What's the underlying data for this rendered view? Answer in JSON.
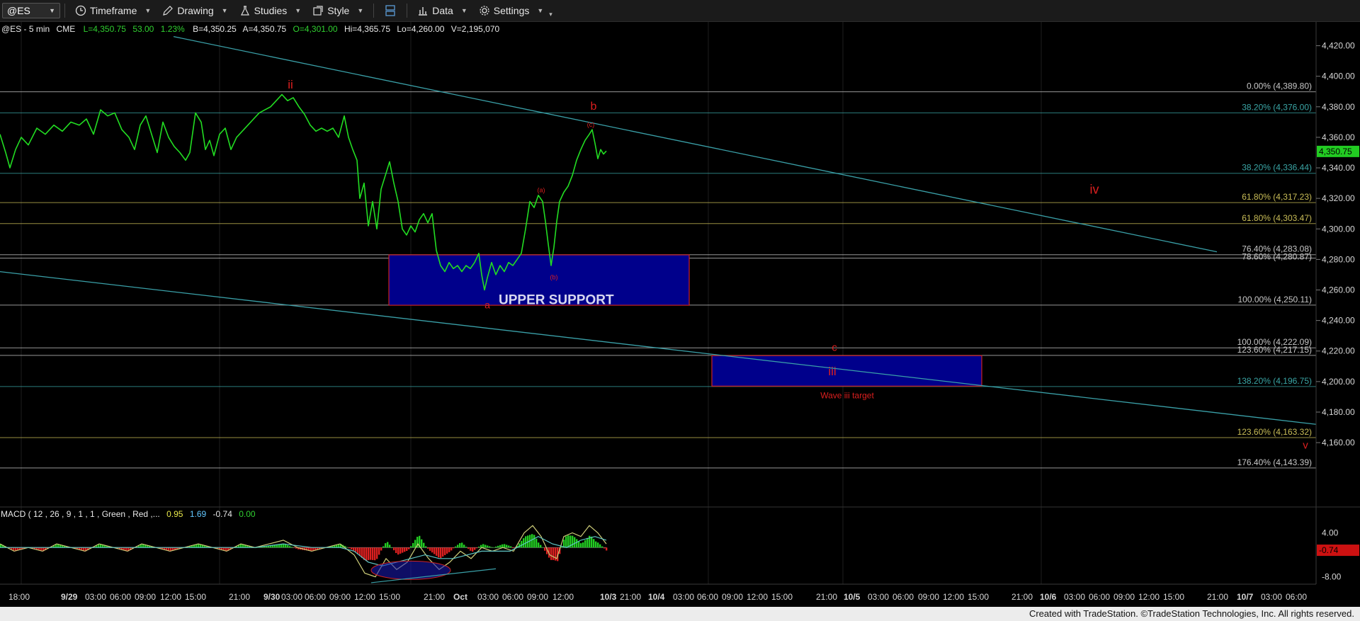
{
  "toolbar": {
    "symbol": "@ES",
    "timeframe_label": "Timeframe",
    "drawing_label": "Drawing",
    "studies_label": "Studies",
    "style_label": "Style",
    "data_label": "Data",
    "settings_label": "Settings"
  },
  "header": {
    "symbol_interval": "@ES - 5 min",
    "exchange": "CME",
    "last": "L=4,350.75",
    "change": "53.00",
    "change_pct": "1.23%",
    "bid": "B=4,350.25",
    "ask": "A=4,350.75",
    "open": "O=4,301.00",
    "high": "Hi=4,365.75",
    "low": "Lo=4,260.00",
    "volume": "V=2,195,070"
  },
  "macd_header": {
    "label": "MACD ( 12 , 26 , 9 , 1 , 1 , Green , Red ,...",
    "v1": "0.95",
    "v2": "1.69",
    "v3": "-0.74",
    "v4": "0.00"
  },
  "chart_data": {
    "type": "line",
    "symbol": "@ES",
    "interval": "5 min",
    "ylim": [
      4135,
      4430
    ],
    "y_ticks": [
      "4,420.00",
      "4,400.00",
      "4,380.00",
      "4,360.00",
      "4,340.00",
      "4,320.00",
      "4,300.00",
      "4,280.00",
      "4,260.00",
      "4,240.00",
      "4,220.00",
      "4,200.00",
      "4,180.00",
      "4,160.00"
    ],
    "last_price_tag": "4,350.75",
    "x_ticks": [
      "18:00",
      "9/29",
      "03:00",
      "06:00",
      "09:00",
      "12:00",
      "15:00",
      "21:00",
      "9/30",
      "03:00",
      "06:00",
      "09:00",
      "12:00",
      "15:00",
      "21:00",
      "Oct",
      "03:00",
      "06:00",
      "09:00",
      "12:00",
      "10/3",
      "21:00",
      "10/4",
      "03:00",
      "06:00",
      "09:00",
      "12:00",
      "15:00",
      "21:00",
      "10/5",
      "03:00",
      "06:00",
      "09:00",
      "12:00",
      "15:00",
      "21:00",
      "10/6",
      "03:00",
      "06:00",
      "09:00",
      "12:00",
      "15:00",
      "21:00",
      "10/7",
      "03:00",
      "06:00"
    ],
    "price_series": [
      {
        "x": 0,
        "y": 4362
      },
      {
        "x": 8,
        "y": 4350
      },
      {
        "x": 14,
        "y": 4340
      },
      {
        "x": 22,
        "y": 4352
      },
      {
        "x": 30,
        "y": 4360
      },
      {
        "x": 40,
        "y": 4355
      },
      {
        "x": 52,
        "y": 4366
      },
      {
        "x": 64,
        "y": 4362
      },
      {
        "x": 76,
        "y": 4368
      },
      {
        "x": 88,
        "y": 4364
      },
      {
        "x": 100,
        "y": 4370
      },
      {
        "x": 112,
        "y": 4368
      },
      {
        "x": 122,
        "y": 4372
      },
      {
        "x": 132,
        "y": 4362
      },
      {
        "x": 142,
        "y": 4378
      },
      {
        "x": 152,
        "y": 4374
      },
      {
        "x": 162,
        "y": 4376
      },
      {
        "x": 172,
        "y": 4365
      },
      {
        "x": 182,
        "y": 4360
      },
      {
        "x": 190,
        "y": 4352
      },
      {
        "x": 198,
        "y": 4368
      },
      {
        "x": 206,
        "y": 4374
      },
      {
        "x": 214,
        "y": 4362
      },
      {
        "x": 222,
        "y": 4350
      },
      {
        "x": 230,
        "y": 4370
      },
      {
        "x": 238,
        "y": 4360
      },
      {
        "x": 246,
        "y": 4354
      },
      {
        "x": 254,
        "y": 4350
      },
      {
        "x": 262,
        "y": 4345
      },
      {
        "x": 268,
        "y": 4350
      },
      {
        "x": 276,
        "y": 4376
      },
      {
        "x": 284,
        "y": 4370
      },
      {
        "x": 290,
        "y": 4352
      },
      {
        "x": 296,
        "y": 4358
      },
      {
        "x": 302,
        "y": 4348
      },
      {
        "x": 310,
        "y": 4362
      },
      {
        "x": 318,
        "y": 4366
      },
      {
        "x": 326,
        "y": 4352
      },
      {
        "x": 334,
        "y": 4360
      },
      {
        "x": 342,
        "y": 4364
      },
      {
        "x": 350,
        "y": 4368
      },
      {
        "x": 358,
        "y": 4372
      },
      {
        "x": 366,
        "y": 4376
      },
      {
        "x": 374,
        "y": 4378
      },
      {
        "x": 382,
        "y": 4380
      },
      {
        "x": 390,
        "y": 4384
      },
      {
        "x": 398,
        "y": 4388
      },
      {
        "x": 406,
        "y": 4384
      },
      {
        "x": 414,
        "y": 4386
      },
      {
        "x": 422,
        "y": 4380
      },
      {
        "x": 430,
        "y": 4375
      },
      {
        "x": 438,
        "y": 4368
      },
      {
        "x": 446,
        "y": 4364
      },
      {
        "x": 454,
        "y": 4366
      },
      {
        "x": 462,
        "y": 4364
      },
      {
        "x": 470,
        "y": 4366
      },
      {
        "x": 478,
        "y": 4360
      },
      {
        "x": 486,
        "y": 4374
      },
      {
        "x": 492,
        "y": 4360
      },
      {
        "x": 498,
        "y": 4352
      },
      {
        "x": 504,
        "y": 4345
      },
      {
        "x": 508,
        "y": 4320
      },
      {
        "x": 514,
        "y": 4330
      },
      {
        "x": 520,
        "y": 4302
      },
      {
        "x": 526,
        "y": 4318
      },
      {
        "x": 532,
        "y": 4300
      },
      {
        "x": 538,
        "y": 4326
      },
      {
        "x": 544,
        "y": 4335
      },
      {
        "x": 550,
        "y": 4344
      },
      {
        "x": 556,
        "y": 4330
      },
      {
        "x": 562,
        "y": 4318
      },
      {
        "x": 568,
        "y": 4300
      },
      {
        "x": 574,
        "y": 4296
      },
      {
        "x": 580,
        "y": 4302
      },
      {
        "x": 586,
        "y": 4298
      },
      {
        "x": 592,
        "y": 4306
      },
      {
        "x": 598,
        "y": 4310
      },
      {
        "x": 604,
        "y": 4304
      },
      {
        "x": 610,
        "y": 4310
      },
      {
        "x": 616,
        "y": 4286
      },
      {
        "x": 622,
        "y": 4276
      },
      {
        "x": 628,
        "y": 4272
      },
      {
        "x": 634,
        "y": 4278
      },
      {
        "x": 640,
        "y": 4274
      },
      {
        "x": 646,
        "y": 4276
      },
      {
        "x": 652,
        "y": 4272
      },
      {
        "x": 658,
        "y": 4276
      },
      {
        "x": 664,
        "y": 4274
      },
      {
        "x": 670,
        "y": 4278
      },
      {
        "x": 676,
        "y": 4284
      },
      {
        "x": 680,
        "y": 4270
      },
      {
        "x": 684,
        "y": 4260
      },
      {
        "x": 688,
        "y": 4268
      },
      {
        "x": 694,
        "y": 4278
      },
      {
        "x": 700,
        "y": 4270
      },
      {
        "x": 706,
        "y": 4276
      },
      {
        "x": 712,
        "y": 4272
      },
      {
        "x": 718,
        "y": 4278
      },
      {
        "x": 724,
        "y": 4276
      },
      {
        "x": 730,
        "y": 4280
      },
      {
        "x": 736,
        "y": 4284
      },
      {
        "x": 742,
        "y": 4300
      },
      {
        "x": 748,
        "y": 4318
      },
      {
        "x": 754,
        "y": 4314
      },
      {
        "x": 760,
        "y": 4322
      },
      {
        "x": 766,
        "y": 4318
      },
      {
        "x": 770,
        "y": 4305
      },
      {
        "x": 774,
        "y": 4290
      },
      {
        "x": 778,
        "y": 4276
      },
      {
        "x": 782,
        "y": 4288
      },
      {
        "x": 786,
        "y": 4305
      },
      {
        "x": 790,
        "y": 4318
      },
      {
        "x": 796,
        "y": 4324
      },
      {
        "x": 802,
        "y": 4328
      },
      {
        "x": 808,
        "y": 4335
      },
      {
        "x": 814,
        "y": 4345
      },
      {
        "x": 820,
        "y": 4352
      },
      {
        "x": 826,
        "y": 4358
      },
      {
        "x": 832,
        "y": 4362
      },
      {
        "x": 836,
        "y": 4365
      },
      {
        "x": 840,
        "y": 4356
      },
      {
        "x": 844,
        "y": 4346
      },
      {
        "x": 848,
        "y": 4352
      },
      {
        "x": 852,
        "y": 4349
      },
      {
        "x": 856,
        "y": 4351
      }
    ],
    "macd": {
      "ylim": [
        -10,
        7
      ],
      "y_ticks": [
        "4.00",
        "-8.00"
      ],
      "current_value_tag": "-0.74",
      "macd_line": [
        {
          "x": 0,
          "y": 1
        },
        {
          "x": 20,
          "y": -1
        },
        {
          "x": 40,
          "y": 0
        },
        {
          "x": 60,
          "y": -1
        },
        {
          "x": 80,
          "y": 1
        },
        {
          "x": 100,
          "y": 0
        },
        {
          "x": 120,
          "y": -1
        },
        {
          "x": 140,
          "y": 1
        },
        {
          "x": 160,
          "y": 0
        },
        {
          "x": 180,
          "y": -1
        },
        {
          "x": 200,
          "y": 1
        },
        {
          "x": 220,
          "y": 0
        },
        {
          "x": 240,
          "y": -1
        },
        {
          "x": 260,
          "y": 0
        },
        {
          "x": 280,
          "y": 1
        },
        {
          "x": 300,
          "y": 0
        },
        {
          "x": 320,
          "y": -1
        },
        {
          "x": 340,
          "y": 1
        },
        {
          "x": 360,
          "y": 0
        },
        {
          "x": 380,
          "y": 1
        },
        {
          "x": 400,
          "y": 2
        },
        {
          "x": 420,
          "y": 0
        },
        {
          "x": 440,
          "y": -1
        },
        {
          "x": 460,
          "y": 0
        },
        {
          "x": 480,
          "y": 1
        },
        {
          "x": 500,
          "y": -2
        },
        {
          "x": 515,
          "y": -7
        },
        {
          "x": 530,
          "y": -8
        },
        {
          "x": 545,
          "y": -3
        },
        {
          "x": 560,
          "y": -6
        },
        {
          "x": 575,
          "y": -4
        },
        {
          "x": 590,
          "y": 1
        },
        {
          "x": 605,
          "y": -3
        },
        {
          "x": 620,
          "y": -6
        },
        {
          "x": 635,
          "y": -4
        },
        {
          "x": 650,
          "y": -1
        },
        {
          "x": 665,
          "y": -3
        },
        {
          "x": 680,
          "y": 0
        },
        {
          "x": 695,
          "y": -1
        },
        {
          "x": 710,
          "y": 0
        },
        {
          "x": 725,
          "y": -1
        },
        {
          "x": 740,
          "y": 4
        },
        {
          "x": 752,
          "y": 6
        },
        {
          "x": 764,
          "y": 3
        },
        {
          "x": 776,
          "y": -2
        },
        {
          "x": 786,
          "y": -3
        },
        {
          "x": 796,
          "y": 3
        },
        {
          "x": 808,
          "y": 4
        },
        {
          "x": 820,
          "y": 3
        },
        {
          "x": 832,
          "y": 6
        },
        {
          "x": 844,
          "y": 4
        },
        {
          "x": 856,
          "y": 1
        }
      ],
      "signal_line": [
        {
          "x": 0,
          "y": 0
        },
        {
          "x": 40,
          "y": 0
        },
        {
          "x": 80,
          "y": 0
        },
        {
          "x": 120,
          "y": 0
        },
        {
          "x": 160,
          "y": 0
        },
        {
          "x": 200,
          "y": 0
        },
        {
          "x": 240,
          "y": 0
        },
        {
          "x": 280,
          "y": 0
        },
        {
          "x": 320,
          "y": 0
        },
        {
          "x": 360,
          "y": 0
        },
        {
          "x": 400,
          "y": 1
        },
        {
          "x": 440,
          "y": 0
        },
        {
          "x": 480,
          "y": 0
        },
        {
          "x": 500,
          "y": -1
        },
        {
          "x": 520,
          "y": -4
        },
        {
          "x": 540,
          "y": -5
        },
        {
          "x": 560,
          "y": -4
        },
        {
          "x": 580,
          "y": -3
        },
        {
          "x": 600,
          "y": -2
        },
        {
          "x": 620,
          "y": -3
        },
        {
          "x": 640,
          "y": -3
        },
        {
          "x": 660,
          "y": -2
        },
        {
          "x": 680,
          "y": -1
        },
        {
          "x": 700,
          "y": -1
        },
        {
          "x": 720,
          "y": -1
        },
        {
          "x": 740,
          "y": 1
        },
        {
          "x": 760,
          "y": 3
        },
        {
          "x": 780,
          "y": 1
        },
        {
          "x": 800,
          "y": 0
        },
        {
          "x": 820,
          "y": 2
        },
        {
          "x": 840,
          "y": 3
        },
        {
          "x": 856,
          "y": 2
        }
      ]
    },
    "fib_labels": [
      {
        "text": "0.00% (4,389.80)",
        "price": 4389.8,
        "color": "#c8c8c8"
      },
      {
        "text": "38.20% (4,376.00)",
        "price": 4376.0,
        "color": "#3aa5a5"
      },
      {
        "text": "38.20% (4,336.44)",
        "price": 4336.44,
        "color": "#3aa5a5"
      },
      {
        "text": "61.80% (4,317.23)",
        "price": 4317.23,
        "color": "#c9bd57"
      },
      {
        "text": "61.80% (4,303.47)",
        "price": 4303.47,
        "color": "#c9bd57"
      },
      {
        "text": "76.40% (4,283.08)",
        "price": 4283.08,
        "color": "#c8c8c8"
      },
      {
        "text": "78.60% (4,280.87)",
        "price": 4280.87,
        "color": "#c8c8c8"
      },
      {
        "text": "100.00% (4,250.11)",
        "price": 4250.11,
        "color": "#c8c8c8"
      },
      {
        "text": "100.00% (4,222.09)",
        "price": 4222.09,
        "color": "#c8c8c8"
      },
      {
        "text": "123.60% (4,217.15)",
        "price": 4217.15,
        "color": "#c8c8c8"
      },
      {
        "text": "138.20% (4,196.75)",
        "price": 4196.75,
        "color": "#3aa5a5"
      },
      {
        "text": "123.60% (4,163.32)",
        "price": 4163.32,
        "color": "#c9bd57"
      },
      {
        "text": "176.40% (4,143.39)",
        "price": 4143.39,
        "color": "#c8c8c8"
      }
    ],
    "zones": [
      {
        "label": "UPPER SUPPORT",
        "top": 4283,
        "bottom": 4250
      },
      {
        "label": "",
        "top": 4217,
        "bottom": 4197
      }
    ],
    "wave_labels": {
      "ii": "ii",
      "b": "b",
      "c_small": "(c)",
      "a_small": "(a)",
      "b_small": "(b)",
      "a": "a",
      "iv": "iv",
      "c": "c",
      "iii": "iii",
      "target": "Wave iii target",
      "v": "v"
    },
    "colors": {
      "price": "#22dd22",
      "trendline": "#3aa0a8",
      "zone_fill": "#00008b",
      "zone_border": "#cc2222",
      "wave_label": "#dd1f1f",
      "last_tag": "#22cc22",
      "macd_tag": "#cc1111"
    }
  },
  "footer": {
    "credit": "Created with TradeStation. ©TradeStation Technologies, Inc. All rights reserved."
  }
}
